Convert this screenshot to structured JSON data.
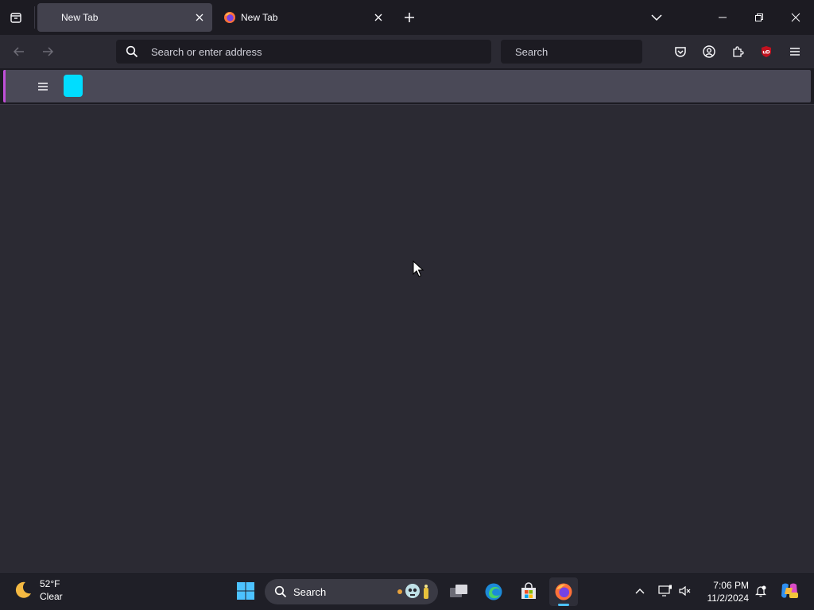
{
  "browser": {
    "tabs": [
      {
        "title": "New Tab",
        "active": true
      },
      {
        "title": "New Tab",
        "active": false
      }
    ],
    "urlbar": {
      "placeholder": "Search or enter address"
    },
    "searchbar": {
      "placeholder": "Search"
    },
    "extension_badge": "uD"
  },
  "taskbar": {
    "weather": {
      "temp": "52°F",
      "condition": "Clear"
    },
    "search_label": "Search",
    "clock": {
      "time": "7:06 PM",
      "date": "11/2/2024"
    }
  },
  "colors": {
    "accent_tile": "#00ddff",
    "ublock_red": "#c1121f",
    "firefox_orange": "#ff7139",
    "taskbar_indicator": "#4cc2ff"
  }
}
